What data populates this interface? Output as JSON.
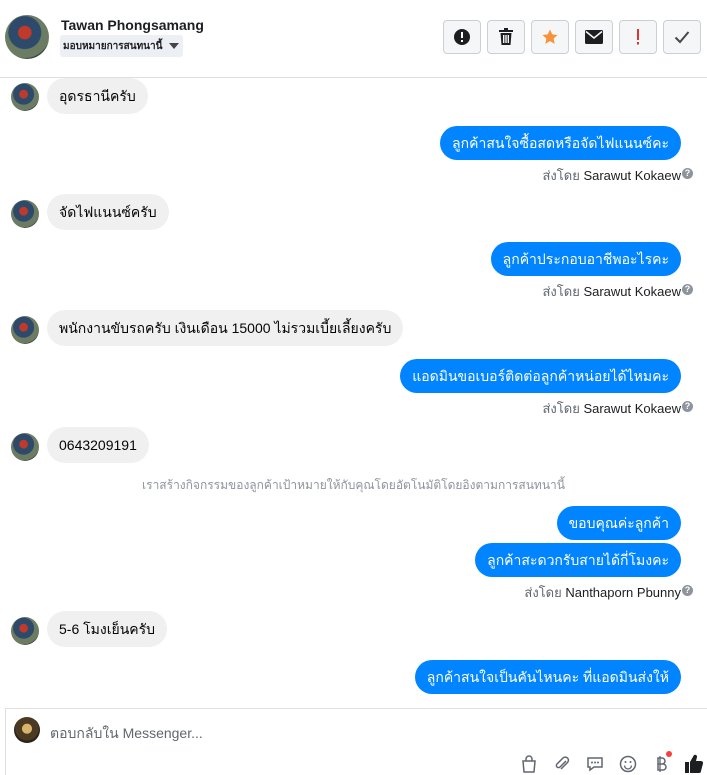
{
  "header": {
    "name": "Tawan Phongsamang",
    "assign_label": "มอบหมายการสนทนานี้"
  },
  "actions": [
    {
      "name": "spam-button",
      "icon": "alert-circle-icon"
    },
    {
      "name": "delete-button",
      "icon": "trash-icon"
    },
    {
      "name": "star-button",
      "icon": "star-icon"
    },
    {
      "name": "mark-unread-button",
      "icon": "envelope-icon"
    },
    {
      "name": "follow-up-button",
      "icon": "exclamation-icon"
    },
    {
      "name": "mark-done-button",
      "icon": "check-icon"
    }
  ],
  "messages": {
    "m1": "อุดรธานีครับ",
    "m2": "ลูกค้าสนใจซื้อสดหรือจัดไฟแนนซ์คะ",
    "m2_sent_prefix": "ส่งโดย",
    "m2_sent_by": "Sarawut Kokaew",
    "m3": "จัดไฟแนนซ์ครับ",
    "m4": "ลูกค้าประกอบอาชีพอะไรคะ",
    "m4_sent_prefix": "ส่งโดย",
    "m4_sent_by": "Sarawut Kokaew",
    "m5": "พนักงานขับรถครับ เงินเดือน 15000 ไม่รวมเบี้ยเลี้ยงครับ",
    "m6": "แอดมินขอเบอร์ติดต่อลูกค้าหน่อยได้ไหมคะ",
    "m6_sent_prefix": "ส่งโดย",
    "m6_sent_by": "Sarawut Kokaew",
    "m7": "0643209191",
    "system_note": "เราสร้างกิจกรรมของลูกค้าเป้าหมายให้กับคุณโดยอัตโนมัติโดยอิงตามการสนทนานี้",
    "m8": "ขอบคุณค่ะลูกค้า",
    "m9": "ลูกค้าสะดวกรับสายได้กี่โมงคะ",
    "m9_sent_prefix": "ส่งโดย",
    "m9_sent_by": "Nanthaporn Pbunny",
    "m10": "5-6 โมงเย็นครับ",
    "m11": "ลูกค้าสนใจเป็นคันไหนคะ ที่แอดมินส่งให้"
  },
  "composer": {
    "placeholder": "ตอบกลับใน Messenger..."
  },
  "colors": {
    "outgoing": "#0084ff",
    "incoming": "#f0f0f0",
    "star": "#f7923a",
    "alert": "#e4312b"
  }
}
